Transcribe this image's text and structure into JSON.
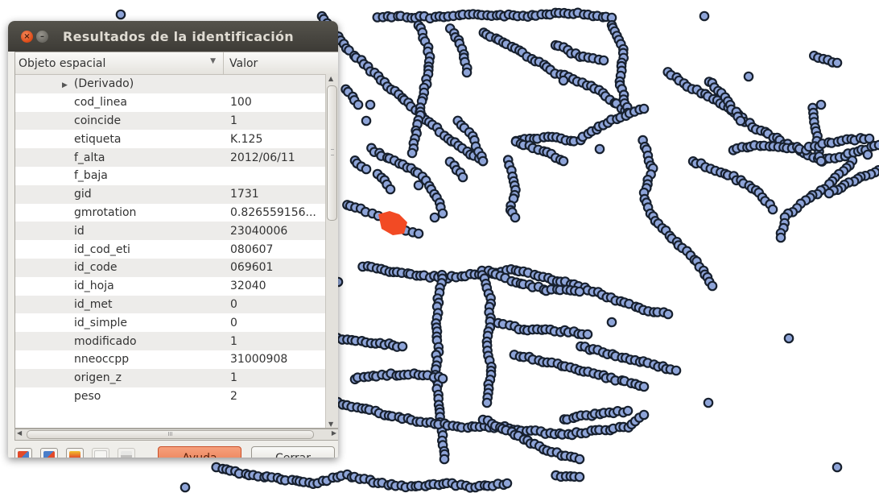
{
  "window": {
    "title": "Resultados de la identificación",
    "close_glyph": "×",
    "minimize_glyph": "–"
  },
  "table": {
    "headers": {
      "feature": "Objeto espacial",
      "value": "Valor",
      "sort_glyph": "▼"
    },
    "derived_label": "(Derivado)",
    "attributes": [
      {
        "name": "cod_linea",
        "value": "100"
      },
      {
        "name": "coincide",
        "value": "1"
      },
      {
        "name": "etiqueta",
        "value": "K.125"
      },
      {
        "name": "f_alta",
        "value": "2012/06/11"
      },
      {
        "name": "f_baja",
        "value": ""
      },
      {
        "name": "gid",
        "value": "1731"
      },
      {
        "name": "gmrotation",
        "value": "0.826559156..."
      },
      {
        "name": "id",
        "value": "23040006"
      },
      {
        "name": "id_cod_eti",
        "value": "080607"
      },
      {
        "name": "id_code",
        "value": "069601"
      },
      {
        "name": "id_hoja",
        "value": "32040"
      },
      {
        "name": "id_met",
        "value": "0"
      },
      {
        "name": "id_simple",
        "value": "0"
      },
      {
        "name": "modificado",
        "value": "1"
      },
      {
        "name": "nneoccpp",
        "value": "31000908"
      },
      {
        "name": "origen_z",
        "value": "1"
      },
      {
        "name": "peso",
        "value": "2"
      }
    ]
  },
  "buttons": {
    "help": "Ayuda",
    "close": "Cerrar"
  },
  "scrollbar": {
    "grip": "III"
  },
  "map": {
    "point_fill": "#8ea4d8",
    "point_stroke": "#17202e",
    "selected_fill": "#f24a24",
    "background": "#ffffff"
  }
}
